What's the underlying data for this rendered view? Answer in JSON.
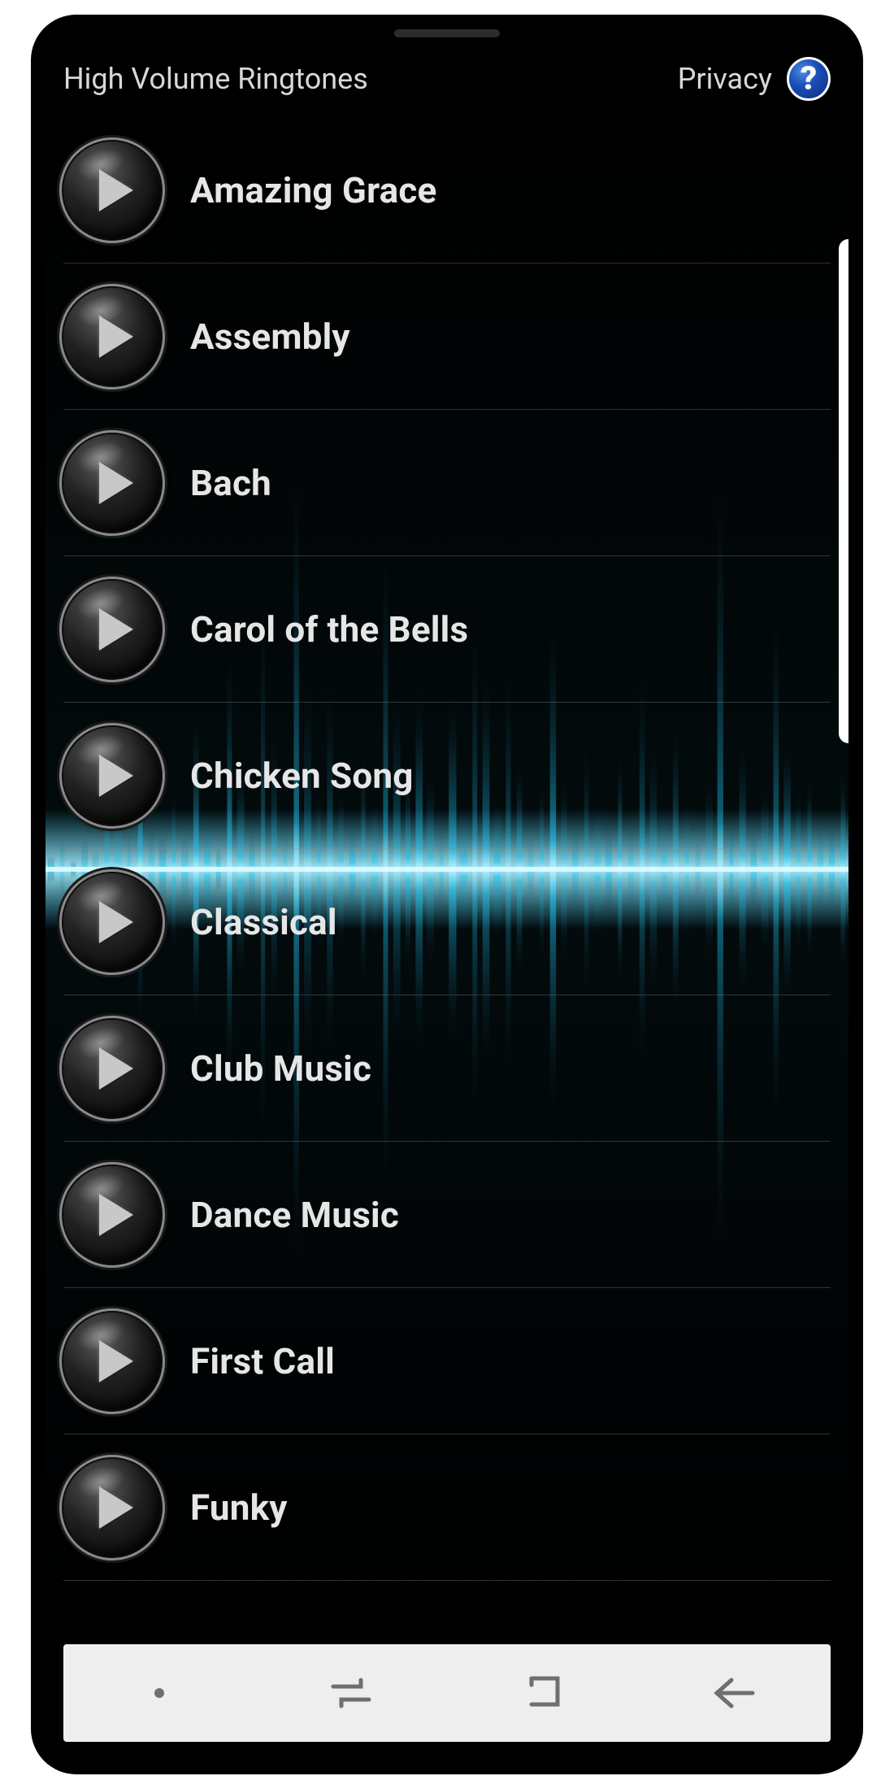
{
  "header": {
    "title": "High Volume Ringtones",
    "privacy_label": "Privacy",
    "help_glyph": "?"
  },
  "ringtones": [
    {
      "label": "Amazing Grace"
    },
    {
      "label": "Assembly"
    },
    {
      "label": "Bach"
    },
    {
      "label": "Carol of the Bells"
    },
    {
      "label": "Chicken Song"
    },
    {
      "label": "Classical"
    },
    {
      "label": "Club Music"
    },
    {
      "label": "Dance Music"
    },
    {
      "label": "First Call"
    },
    {
      "label": "Funky"
    }
  ],
  "colors": {
    "accent": "#3bd6ff",
    "help_bg": "#1a4fb8"
  }
}
